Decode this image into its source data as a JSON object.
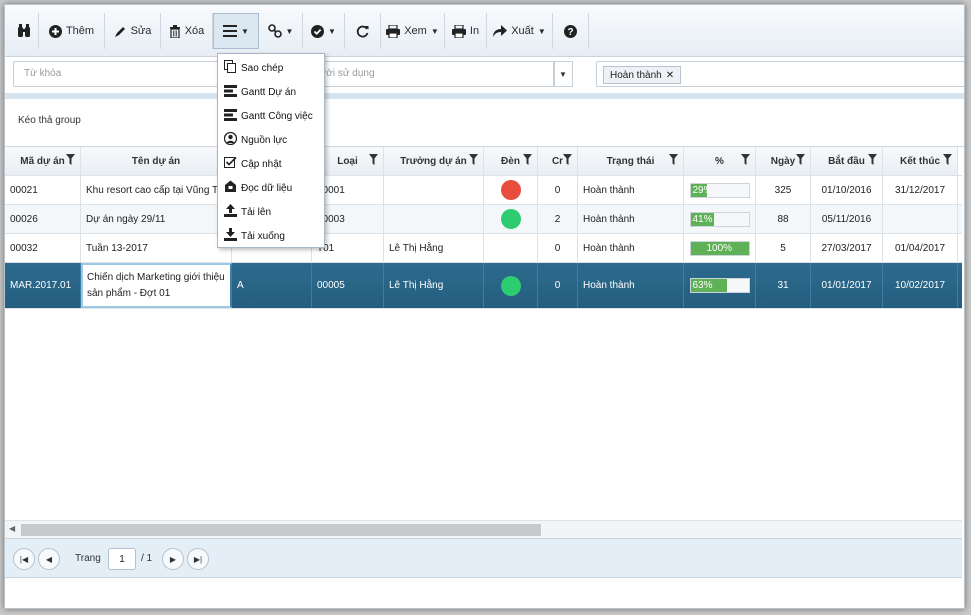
{
  "toolbar": {
    "add_label": "Thêm",
    "edit_label": "Sửa",
    "delete_label": "Xóa",
    "view_label": "Xem",
    "print_label": "In",
    "export_label": "Xuất",
    "icons": [
      "binoculars-icon",
      "plus-circle-icon",
      "pencil-icon",
      "trash-icon",
      "menu-icon",
      "link-icon",
      "check-circle-icon",
      "refresh-icon",
      "printer-icon",
      "printer-icon",
      "share-icon",
      "help-icon"
    ]
  },
  "menu": {
    "items": [
      {
        "label": "Sao chép",
        "icon": "copy-icon"
      },
      {
        "label": "Gantt Dự án",
        "icon": "gantt-icon"
      },
      {
        "label": "Gantt Công việc",
        "icon": "gantt-icon"
      },
      {
        "label": "Nguồn lực",
        "icon": "user-circle-icon"
      },
      {
        "label": "Cập nhật",
        "icon": "checkbox-icon"
      },
      {
        "label": "Đọc dữ liệu",
        "icon": "read-data-icon"
      },
      {
        "label": "Tải lên",
        "icon": "upload-icon"
      },
      {
        "label": "Tải xuống",
        "icon": "download-icon"
      }
    ]
  },
  "filter": {
    "keyword_placeholder": "Từ khóa",
    "user_placeholder": "gười sử dụng",
    "status_chip": "Hoàn thành"
  },
  "group_bar": {
    "label": "Kéo thả group"
  },
  "grid": {
    "columns": [
      "Mã dự án",
      "Tên dự án",
      "",
      "Loại",
      "Trưởng dự án",
      "Đèn",
      "Cr",
      "Trạng thái",
      "%",
      "Ngày",
      "Bắt đầu",
      "Kết thúc"
    ],
    "rows": [
      {
        "code": "00021",
        "name": "Khu resort cao cấp tại Vũng Tàu",
        "x": "",
        "type": "00001",
        "lead": "",
        "light": "#e74c3c",
        "cr": "0",
        "status": "Hoàn thành",
        "pct": 29,
        "pct_label": "29%",
        "days": "325",
        "start": "01/10/2016",
        "end": "31/12/2017"
      },
      {
        "code": "00026",
        "name": "Dự án ngày 29/11",
        "x": "",
        "type": "00003",
        "lead": "",
        "light": "#2ecc71",
        "cr": "2",
        "status": "Hoàn thành",
        "pct": 41,
        "pct_label": "41%",
        "days": "88",
        "start": "05/11/2016",
        "end": ""
      },
      {
        "code": "00032",
        "name": "Tuần 13-2017",
        "x": "",
        "type": "T01",
        "lead": "Lê Thị Hằng",
        "light": "",
        "cr": "0",
        "status": "Hoàn thành",
        "pct": 100,
        "pct_label": "100%",
        "days": "5",
        "start": "27/03/2017",
        "end": "01/04/2017"
      },
      {
        "code": "MAR.2017.01",
        "name": "Chiến dịch Marketing giới thiệu sản phẩm - Đợt 01",
        "x": "A",
        "type": "00005",
        "lead": "Lê Thị Hằng",
        "light": "#2ecc71",
        "cr": "0",
        "status": "Hoàn thành",
        "pct": 63,
        "pct_label": "63%",
        "days": "31",
        "start": "01/01/2017",
        "end": "10/02/2017"
      }
    ]
  },
  "pager": {
    "page_label": "Trang",
    "page_value": "1",
    "total": "/ 1"
  }
}
